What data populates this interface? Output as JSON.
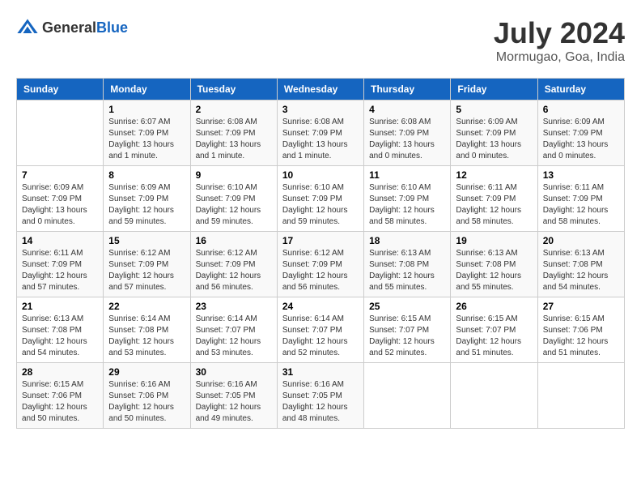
{
  "header": {
    "logo": {
      "general": "General",
      "blue": "Blue"
    },
    "title": "July 2024",
    "location": "Mormugao, Goa, India"
  },
  "days_of_week": [
    "Sunday",
    "Monday",
    "Tuesday",
    "Wednesday",
    "Thursday",
    "Friday",
    "Saturday"
  ],
  "weeks": [
    [
      {
        "day": "",
        "sunrise": "",
        "sunset": "",
        "daylight": ""
      },
      {
        "day": "1",
        "sunrise": "Sunrise: 6:07 AM",
        "sunset": "Sunset: 7:09 PM",
        "daylight": "Daylight: 13 hours and 1 minute."
      },
      {
        "day": "2",
        "sunrise": "Sunrise: 6:08 AM",
        "sunset": "Sunset: 7:09 PM",
        "daylight": "Daylight: 13 hours and 1 minute."
      },
      {
        "day": "3",
        "sunrise": "Sunrise: 6:08 AM",
        "sunset": "Sunset: 7:09 PM",
        "daylight": "Daylight: 13 hours and 1 minute."
      },
      {
        "day": "4",
        "sunrise": "Sunrise: 6:08 AM",
        "sunset": "Sunset: 7:09 PM",
        "daylight": "Daylight: 13 hours and 0 minutes."
      },
      {
        "day": "5",
        "sunrise": "Sunrise: 6:09 AM",
        "sunset": "Sunset: 7:09 PM",
        "daylight": "Daylight: 13 hours and 0 minutes."
      },
      {
        "day": "6",
        "sunrise": "Sunrise: 6:09 AM",
        "sunset": "Sunset: 7:09 PM",
        "daylight": "Daylight: 13 hours and 0 minutes."
      }
    ],
    [
      {
        "day": "7",
        "sunrise": "Sunrise: 6:09 AM",
        "sunset": "Sunset: 7:09 PM",
        "daylight": "Daylight: 13 hours and 0 minutes."
      },
      {
        "day": "8",
        "sunrise": "Sunrise: 6:09 AM",
        "sunset": "Sunset: 7:09 PM",
        "daylight": "Daylight: 12 hours and 59 minutes."
      },
      {
        "day": "9",
        "sunrise": "Sunrise: 6:10 AM",
        "sunset": "Sunset: 7:09 PM",
        "daylight": "Daylight: 12 hours and 59 minutes."
      },
      {
        "day": "10",
        "sunrise": "Sunrise: 6:10 AM",
        "sunset": "Sunset: 7:09 PM",
        "daylight": "Daylight: 12 hours and 59 minutes."
      },
      {
        "day": "11",
        "sunrise": "Sunrise: 6:10 AM",
        "sunset": "Sunset: 7:09 PM",
        "daylight": "Daylight: 12 hours and 58 minutes."
      },
      {
        "day": "12",
        "sunrise": "Sunrise: 6:11 AM",
        "sunset": "Sunset: 7:09 PM",
        "daylight": "Daylight: 12 hours and 58 minutes."
      },
      {
        "day": "13",
        "sunrise": "Sunrise: 6:11 AM",
        "sunset": "Sunset: 7:09 PM",
        "daylight": "Daylight: 12 hours and 58 minutes."
      }
    ],
    [
      {
        "day": "14",
        "sunrise": "Sunrise: 6:11 AM",
        "sunset": "Sunset: 7:09 PM",
        "daylight": "Daylight: 12 hours and 57 minutes."
      },
      {
        "day": "15",
        "sunrise": "Sunrise: 6:12 AM",
        "sunset": "Sunset: 7:09 PM",
        "daylight": "Daylight: 12 hours and 57 minutes."
      },
      {
        "day": "16",
        "sunrise": "Sunrise: 6:12 AM",
        "sunset": "Sunset: 7:09 PM",
        "daylight": "Daylight: 12 hours and 56 minutes."
      },
      {
        "day": "17",
        "sunrise": "Sunrise: 6:12 AM",
        "sunset": "Sunset: 7:09 PM",
        "daylight": "Daylight: 12 hours and 56 minutes."
      },
      {
        "day": "18",
        "sunrise": "Sunrise: 6:13 AM",
        "sunset": "Sunset: 7:08 PM",
        "daylight": "Daylight: 12 hours and 55 minutes."
      },
      {
        "day": "19",
        "sunrise": "Sunrise: 6:13 AM",
        "sunset": "Sunset: 7:08 PM",
        "daylight": "Daylight: 12 hours and 55 minutes."
      },
      {
        "day": "20",
        "sunrise": "Sunrise: 6:13 AM",
        "sunset": "Sunset: 7:08 PM",
        "daylight": "Daylight: 12 hours and 54 minutes."
      }
    ],
    [
      {
        "day": "21",
        "sunrise": "Sunrise: 6:13 AM",
        "sunset": "Sunset: 7:08 PM",
        "daylight": "Daylight: 12 hours and 54 minutes."
      },
      {
        "day": "22",
        "sunrise": "Sunrise: 6:14 AM",
        "sunset": "Sunset: 7:08 PM",
        "daylight": "Daylight: 12 hours and 53 minutes."
      },
      {
        "day": "23",
        "sunrise": "Sunrise: 6:14 AM",
        "sunset": "Sunset: 7:07 PM",
        "daylight": "Daylight: 12 hours and 53 minutes."
      },
      {
        "day": "24",
        "sunrise": "Sunrise: 6:14 AM",
        "sunset": "Sunset: 7:07 PM",
        "daylight": "Daylight: 12 hours and 52 minutes."
      },
      {
        "day": "25",
        "sunrise": "Sunrise: 6:15 AM",
        "sunset": "Sunset: 7:07 PM",
        "daylight": "Daylight: 12 hours and 52 minutes."
      },
      {
        "day": "26",
        "sunrise": "Sunrise: 6:15 AM",
        "sunset": "Sunset: 7:07 PM",
        "daylight": "Daylight: 12 hours and 51 minutes."
      },
      {
        "day": "27",
        "sunrise": "Sunrise: 6:15 AM",
        "sunset": "Sunset: 7:06 PM",
        "daylight": "Daylight: 12 hours and 51 minutes."
      }
    ],
    [
      {
        "day": "28",
        "sunrise": "Sunrise: 6:15 AM",
        "sunset": "Sunset: 7:06 PM",
        "daylight": "Daylight: 12 hours and 50 minutes."
      },
      {
        "day": "29",
        "sunrise": "Sunrise: 6:16 AM",
        "sunset": "Sunset: 7:06 PM",
        "daylight": "Daylight: 12 hours and 50 minutes."
      },
      {
        "day": "30",
        "sunrise": "Sunrise: 6:16 AM",
        "sunset": "Sunset: 7:05 PM",
        "daylight": "Daylight: 12 hours and 49 minutes."
      },
      {
        "day": "31",
        "sunrise": "Sunrise: 6:16 AM",
        "sunset": "Sunset: 7:05 PM",
        "daylight": "Daylight: 12 hours and 48 minutes."
      },
      {
        "day": "",
        "sunrise": "",
        "sunset": "",
        "daylight": ""
      },
      {
        "day": "",
        "sunrise": "",
        "sunset": "",
        "daylight": ""
      },
      {
        "day": "",
        "sunrise": "",
        "sunset": "",
        "daylight": ""
      }
    ]
  ]
}
